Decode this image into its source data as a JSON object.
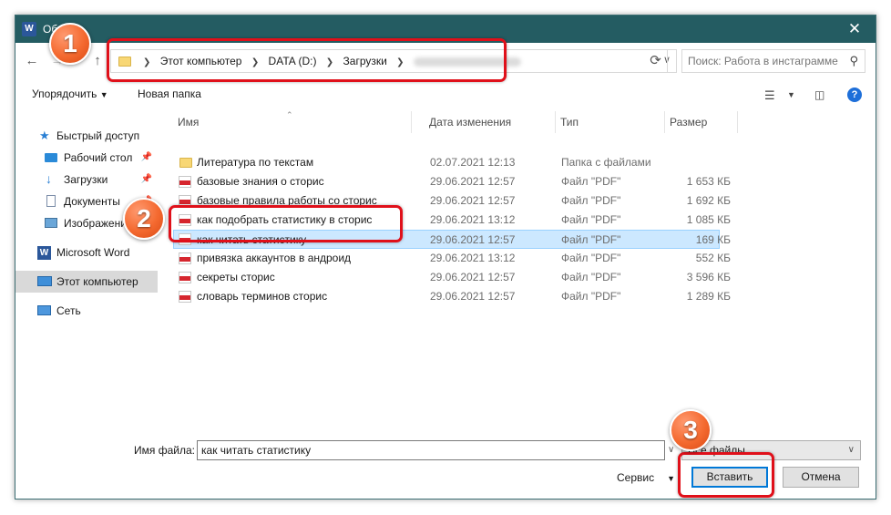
{
  "window": {
    "title": "Об",
    "app_icon": "W",
    "close_glyph": "✕"
  },
  "address": {
    "crumbs": [
      "Этот компьютер",
      "DATA (D:)",
      "Загрузки"
    ],
    "last_crumb_blurred": true
  },
  "search": {
    "placeholder": "Поиск: Работа в инстаграмме"
  },
  "toolbar": {
    "organize_label": "Упорядочить",
    "new_folder_label": "Новая папка"
  },
  "sidebar": {
    "items": [
      {
        "label": "Быстрый доступ",
        "icon": "star-icon",
        "pinned": false,
        "selected": false
      },
      {
        "label": "Рабочий стол",
        "icon": "desktop-icon",
        "pinned": true,
        "selected": false
      },
      {
        "label": "Загрузки",
        "icon": "downloads-icon",
        "pinned": true,
        "selected": false
      },
      {
        "label": "Документы",
        "icon": "documents-icon",
        "pinned": true,
        "selected": false
      },
      {
        "label": "Изображения",
        "icon": "pictures-icon",
        "pinned": true,
        "selected": false
      },
      {
        "label": "Microsoft Word",
        "icon": "word-icon",
        "pinned": false,
        "selected": false
      },
      {
        "label": "Этот компьютер",
        "icon": "computer-icon",
        "pinned": false,
        "selected": true
      },
      {
        "label": "Сеть",
        "icon": "network-icon",
        "pinned": false,
        "selected": false
      }
    ]
  },
  "columns": {
    "name": "Имя",
    "date": "Дата изменения",
    "type": "Тип",
    "size": "Размер"
  },
  "files": [
    {
      "name": "Литература  по текстам",
      "date": "02.07.2021 12:13",
      "type": "Папка с файлами",
      "size": "",
      "kind": "folder"
    },
    {
      "name": "базовые знания о сторис",
      "date": "29.06.2021 12:57",
      "type": "Файл \"PDF\"",
      "size": "1 653 КБ",
      "kind": "pdf"
    },
    {
      "name": "базовые правила работы со сторис",
      "date": "29.06.2021 12:57",
      "type": "Файл \"PDF\"",
      "size": "1 692 КБ",
      "kind": "pdf"
    },
    {
      "name": "как подобрать статистику в сторис",
      "date": "29.06.2021 13:12",
      "type": "Файл \"PDF\"",
      "size": "1 085 КБ",
      "kind": "pdf"
    },
    {
      "name": "как читать статистику",
      "date": "29.06.2021 12:57",
      "type": "Файл \"PDF\"",
      "size": "169 КБ",
      "kind": "pdf",
      "selected": true
    },
    {
      "name": "привязка аккаунтов в андроид",
      "date": "29.06.2021 13:12",
      "type": "Файл \"PDF\"",
      "size": "552 КБ",
      "kind": "pdf"
    },
    {
      "name": "секреты сторис",
      "date": "29.06.2021 12:57",
      "type": "Файл \"PDF\"",
      "size": "3 596 КБ",
      "kind": "pdf"
    },
    {
      "name": "словарь терминов сторис",
      "date": "29.06.2021 12:57",
      "type": "Файл \"PDF\"",
      "size": "1 289 КБ",
      "kind": "pdf"
    }
  ],
  "bottom": {
    "filename_label": "Имя файла:",
    "filename_value": "как читать статистику",
    "filetype_value": "Все файлы",
    "tools_label": "Сервис",
    "insert_label": "Вставить",
    "cancel_label": "Отмена"
  },
  "callouts": [
    "1",
    "2",
    "3"
  ],
  "colors": {
    "titlebar": "#245c62",
    "selection": "#cce8ff",
    "callout_border": "#e0101a",
    "badge": "#f4692f",
    "primary_border": "#0078d7"
  }
}
